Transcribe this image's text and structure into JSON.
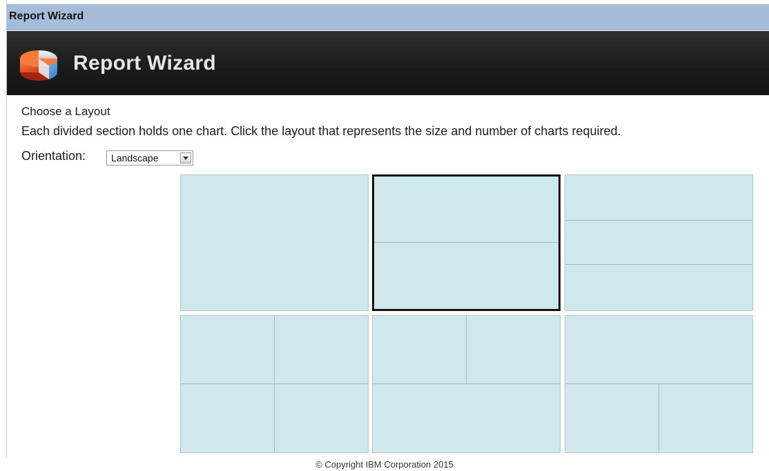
{
  "window": {
    "title": "Report Wizard"
  },
  "header": {
    "title": "Report Wizard",
    "logo_icon": "pie-chart-icon"
  },
  "content": {
    "section_title": "Choose a Layout",
    "instructions": "Each divided section holds one chart. Click the layout that represents the size and number of charts required.",
    "orientation_label": "Orientation:",
    "orientation": {
      "value": "Landscape"
    }
  },
  "layouts": [
    {
      "id": "single",
      "charts": 1,
      "selected": false
    },
    {
      "id": "two-rows",
      "charts": 2,
      "selected": true
    },
    {
      "id": "three-rows",
      "charts": 3,
      "selected": false
    },
    {
      "id": "four-grid",
      "charts": 4,
      "selected": false
    },
    {
      "id": "two-top-one-bottom",
      "charts": 3,
      "selected": false
    },
    {
      "id": "one-top-two-bottom",
      "charts": 3,
      "selected": false
    }
  ],
  "colors": {
    "titlebar": "#a5bdd9",
    "header": "#1a1a1a",
    "layout_fill": "#cfe8ec",
    "selected_border": "#121212"
  },
  "footer": {
    "copyright": "© Copyright IBM Corporation 2015"
  }
}
